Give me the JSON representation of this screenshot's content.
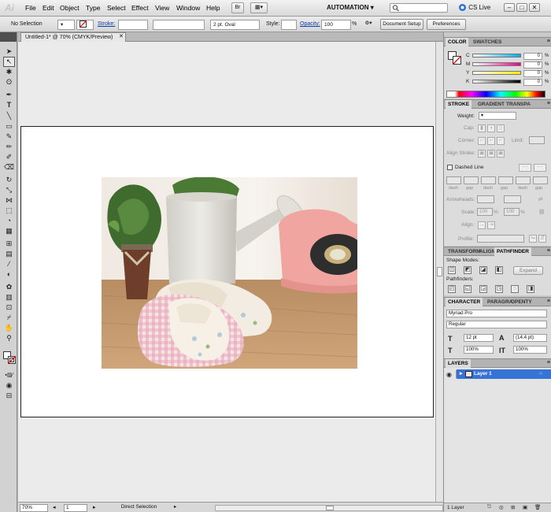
{
  "app": {
    "logo": "Ai",
    "menu": [
      "File",
      "Edit",
      "Object",
      "Type",
      "Select",
      "Effect",
      "View",
      "Window",
      "Help"
    ],
    "workspace": "AUTOMATION",
    "cs_live": "CS Live",
    "window_controls": [
      "–",
      "□",
      "✕"
    ]
  },
  "control_bar": {
    "selection": "No Selection",
    "stroke_label": "Stroke:",
    "brush": "2 pt. Oval",
    "style_label": "Style:",
    "opacity_label": "Opacity:",
    "opacity_value": "100",
    "opacity_unit": "%",
    "document_setup": "Document Setup",
    "preferences": "Preferences"
  },
  "document": {
    "tab_title": "Untitled-1* @ 70% (CMYK/Preview)",
    "close": "✕"
  },
  "status_bar": {
    "zoom": "70%",
    "artboard": "1",
    "tool": "Direct Selection"
  },
  "panels": {
    "color": {
      "tabs": [
        "COLOR",
        "SWATCHES"
      ],
      "channels": [
        {
          "label": "C",
          "value": "0",
          "unit": "%",
          "color": "#00aeef"
        },
        {
          "label": "M",
          "value": "0",
          "unit": "%",
          "color": "#ec008c"
        },
        {
          "label": "Y",
          "value": "0",
          "unit": "%",
          "color": "#fff200"
        },
        {
          "label": "K",
          "value": "0",
          "unit": "%",
          "color": "#000000"
        }
      ]
    },
    "stroke": {
      "tabs": [
        "STROKE",
        "GRADIENT",
        "TRANSPA"
      ],
      "weight_label": "Weight:",
      "cap_label": "Cap:",
      "corner_label": "Corner:",
      "limit_label": "Limit:",
      "align_label": "Align Stroke:",
      "dashed_line": "Dashed Line",
      "dash_labels": [
        "dash",
        "gap",
        "dash",
        "gap",
        "dash",
        "gap"
      ],
      "arrowheads_label": "Arrowheads:",
      "scale_label": "Scale:",
      "scale_values": [
        "100",
        "100"
      ],
      "percent": "%",
      "align_label2": "Align:",
      "profile_label": "Profile:"
    },
    "pathfinder": {
      "tabs": [
        "TRANSFORM",
        "ALIGN",
        "PATHFINDER"
      ],
      "shape_modes": "Shape Modes:",
      "expand": "Expand",
      "pathfinders": "Pathfinders:"
    },
    "character": {
      "tabs": [
        "CHARACTER",
        "PARAGRA",
        "OPENTY"
      ],
      "font": "Myriad Pro",
      "style": "Regular",
      "size": "12 pt",
      "leading": "(14.4 pt)",
      "h_scale": "100%",
      "v_scale": "100%"
    },
    "layers": {
      "tabs": [
        "LAYERS"
      ],
      "layer_name": "Layer 1",
      "count": "1 Layer"
    }
  }
}
